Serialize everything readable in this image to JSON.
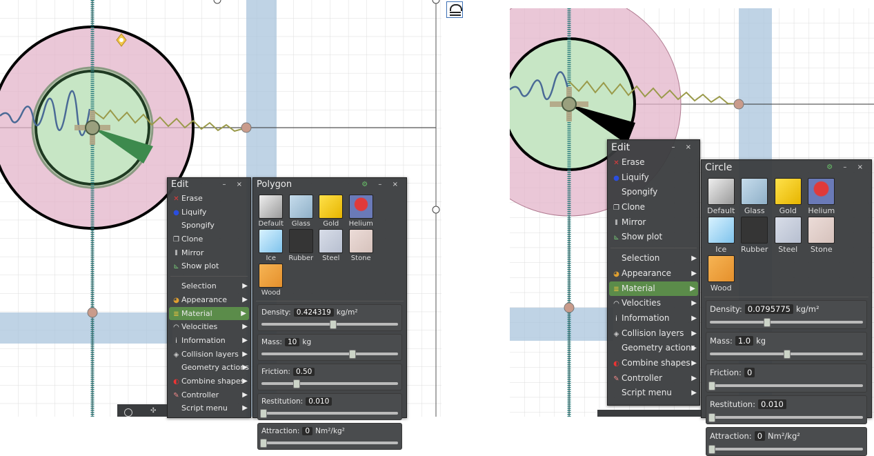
{
  "colors": {
    "accent": "#5b8c4a",
    "panel_bg": "#3a3c3e"
  },
  "left": {
    "edit": {
      "title": "Edit",
      "controls": "– ×",
      "items": [
        {
          "label": "Erase",
          "icon": "red-x-icon"
        },
        {
          "label": "Liquify",
          "icon": "blue-drop-icon"
        },
        {
          "label": "Spongify",
          "icon": ""
        },
        {
          "label": "Clone",
          "icon": "clone-icon"
        },
        {
          "label": "Mirror",
          "icon": "mirror-icon"
        },
        {
          "label": "Show plot",
          "icon": "plot-icon"
        }
      ],
      "submenus": [
        {
          "label": "Selection",
          "icon": "",
          "active": false
        },
        {
          "label": "Appearance",
          "icon": "palette-icon",
          "active": false
        },
        {
          "label": "Material",
          "icon": "material-icon",
          "active": true
        },
        {
          "label": "Velocities",
          "icon": "speedometer-icon",
          "active": false
        },
        {
          "label": "Information",
          "icon": "info-icon",
          "active": false
        },
        {
          "label": "Collision layers",
          "icon": "layers-icon",
          "active": false
        },
        {
          "label": "Geometry actions",
          "icon": "",
          "active": false
        },
        {
          "label": "Combine shapes",
          "icon": "combine-icon",
          "active": false
        },
        {
          "label": "Controller",
          "icon": "controller-icon",
          "active": false
        },
        {
          "label": "Script menu",
          "icon": "",
          "active": false
        }
      ]
    },
    "material": {
      "title": "Polygon",
      "controls": "⚙ – ×",
      "materials": [
        "Default",
        "Glass",
        "Gold",
        "Helium",
        "Ice",
        "Rubber",
        "Steel",
        "Stone",
        "Wood"
      ],
      "sliders": [
        {
          "label": "Density:",
          "value": "0.424319",
          "unit": "kg/m²",
          "fraction": 0.52
        },
        {
          "label": "Mass:",
          "value": "10",
          "unit": "kg",
          "fraction": 0.66
        },
        {
          "label": "Friction:",
          "value": "0.50",
          "unit": "",
          "fraction": 0.25
        },
        {
          "label": "Restitution:",
          "value": "0.010",
          "unit": "",
          "fraction": 0.0
        },
        {
          "label": "Attraction:",
          "value": "0",
          "unit": "Nm²/kg²",
          "fraction": 0.0
        }
      ]
    }
  },
  "right": {
    "edit": {
      "title": "Edit",
      "controls": "– ×",
      "items": [
        {
          "label": "Erase",
          "icon": "red-x-icon"
        },
        {
          "label": "Liquify",
          "icon": "blue-drop-icon"
        },
        {
          "label": "Spongify",
          "icon": ""
        },
        {
          "label": "Clone",
          "icon": "clone-icon"
        },
        {
          "label": "Mirror",
          "icon": "mirror-icon"
        },
        {
          "label": "Show plot",
          "icon": "plot-icon"
        }
      ],
      "submenus": [
        {
          "label": "Selection",
          "icon": "",
          "active": false
        },
        {
          "label": "Appearance",
          "icon": "palette-icon",
          "active": false
        },
        {
          "label": "Material",
          "icon": "material-icon",
          "active": true
        },
        {
          "label": "Velocities",
          "icon": "speedometer-icon",
          "active": false
        },
        {
          "label": "Information",
          "icon": "info-icon",
          "active": false
        },
        {
          "label": "Collision layers",
          "icon": "layers-icon",
          "active": false
        },
        {
          "label": "Geometry actions",
          "icon": "",
          "active": false
        },
        {
          "label": "Combine shapes",
          "icon": "combine-icon",
          "active": false
        },
        {
          "label": "Controller",
          "icon": "controller-icon",
          "active": false
        },
        {
          "label": "Script menu",
          "icon": "",
          "active": false
        }
      ]
    },
    "material": {
      "title": "Circle",
      "controls": "⚙ – ×",
      "materials": [
        "Default",
        "Glass",
        "Gold",
        "Helium",
        "Ice",
        "Rubber",
        "Steel",
        "Stone",
        "Wood"
      ],
      "sliders": [
        {
          "label": "Density:",
          "value": "0.0795775",
          "unit": "kg/m²",
          "fraction": 0.37
        },
        {
          "label": "Mass:",
          "value": "1.0",
          "unit": "kg",
          "fraction": 0.5
        },
        {
          "label": "Friction:",
          "value": "0",
          "unit": "",
          "fraction": 0.0
        },
        {
          "label": "Restitution:",
          "value": "0.010",
          "unit": "",
          "fraction": 0.0
        },
        {
          "label": "Attraction:",
          "value": "0",
          "unit": "Nm²/kg²",
          "fraction": 0.0
        }
      ]
    }
  }
}
